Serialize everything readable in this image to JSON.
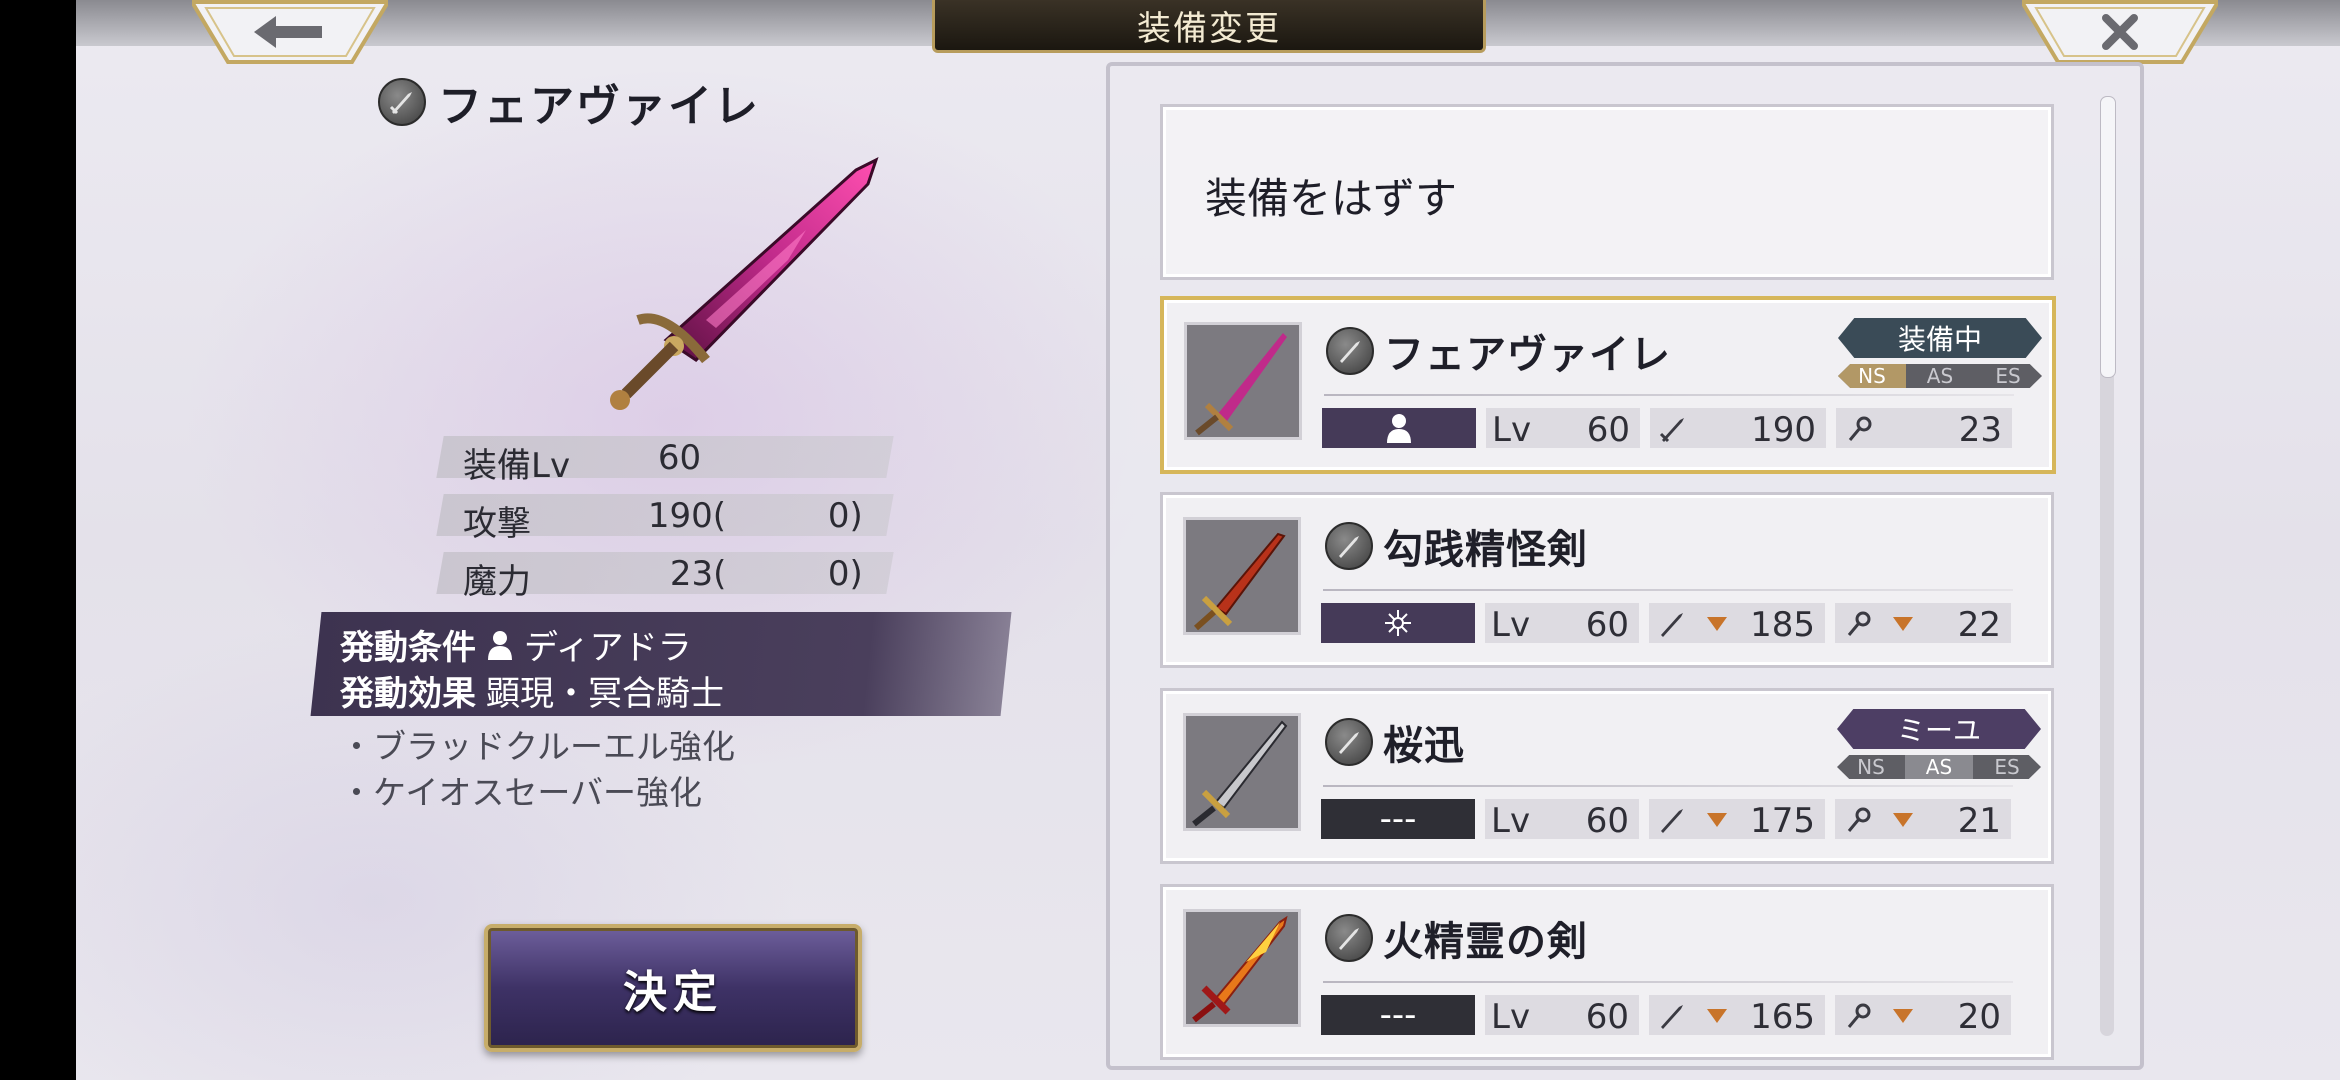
{
  "header": {
    "title": "装備変更",
    "back_icon": "arrow-left-icon",
    "close_icon": "close-icon"
  },
  "detail": {
    "weapon_name": "フェアヴァイレ",
    "stats": [
      {
        "label": "装備Lv",
        "value": "60",
        "bonus": ""
      },
      {
        "label": "攻撃",
        "value": "190(",
        "bonus": "0)"
      },
      {
        "label": "魔力",
        "value": "23(",
        "bonus": "0)"
      }
    ],
    "condition_label": "発動条件",
    "condition_value": "ディアドラ",
    "effect_label": "発動効果",
    "effect_value": "顕現・冥合騎士",
    "bullets": [
      "・ブラッドクルーエル強化",
      "・ケイオスセーバー強化"
    ],
    "decide_label": "決定"
  },
  "list": {
    "unequip_label": "装備をはずす",
    "items": [
      {
        "name": "フェアヴァイレ",
        "slot": "",
        "lv_label": "Lv",
        "lv": "60",
        "atk": "190",
        "mag": "23",
        "tag": "装備中",
        "ns": [
          "NS",
          "AS",
          "ES"
        ]
      },
      {
        "name": "勾践精怪剣",
        "slot": "",
        "lv_label": "Lv",
        "lv": "60",
        "atk": "185",
        "mag": "22",
        "tag": "",
        "ns": []
      },
      {
        "name": "桜迅",
        "slot": "---",
        "lv_label": "Lv",
        "lv": "60",
        "atk": "175",
        "mag": "21",
        "tag": "ミーユ",
        "ns": [
          "NS",
          "AS",
          "ES"
        ]
      },
      {
        "name": "火精霊の剣",
        "slot": "---",
        "lv_label": "Lv",
        "lv": "60",
        "atk": "165",
        "mag": "20",
        "tag": "",
        "ns": []
      }
    ]
  },
  "colors": {
    "accent_gold": "#d6b65a",
    "panel_purple": "#453a58",
    "down_arrow": "#c8742a"
  }
}
